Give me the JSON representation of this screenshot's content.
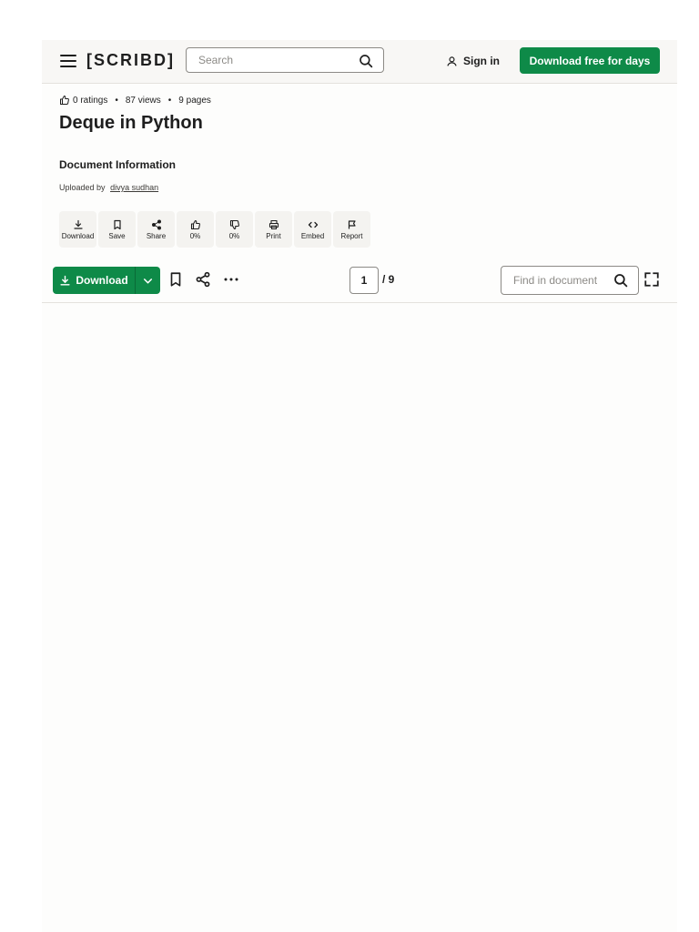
{
  "header": {
    "logo": "[SCRIBD]",
    "search_placeholder": "Search",
    "signin_label": "Sign in",
    "cta_label": "Download free for days"
  },
  "document": {
    "ratings": "0 ratings",
    "views": "87 views",
    "pages": "9 pages",
    "title": "Deque in Python",
    "info_heading": "Document Information",
    "uploaded_by_label": "Uploaded by",
    "uploader": "divya sudhan"
  },
  "actions": [
    {
      "label": "Download",
      "icon": "download-icon"
    },
    {
      "label": "Save",
      "icon": "bookmark-icon"
    },
    {
      "label": "Share",
      "icon": "share-icon"
    },
    {
      "label": "0%",
      "icon": "thumbs-up-icon"
    },
    {
      "label": "0%",
      "icon": "thumbs-down-icon"
    },
    {
      "label": "Print",
      "icon": "print-icon"
    },
    {
      "label": "Embed",
      "icon": "embed-icon"
    },
    {
      "label": "Report",
      "icon": "flag-icon"
    }
  ],
  "toolbar": {
    "download_label": "Download",
    "current_page": "1",
    "page_total": "/ 9",
    "find_placeholder": "Find in document"
  },
  "colors": {
    "brand_green": "#0e8a48",
    "header_bg": "#f8f7f5",
    "text": "#1e1e1e"
  }
}
